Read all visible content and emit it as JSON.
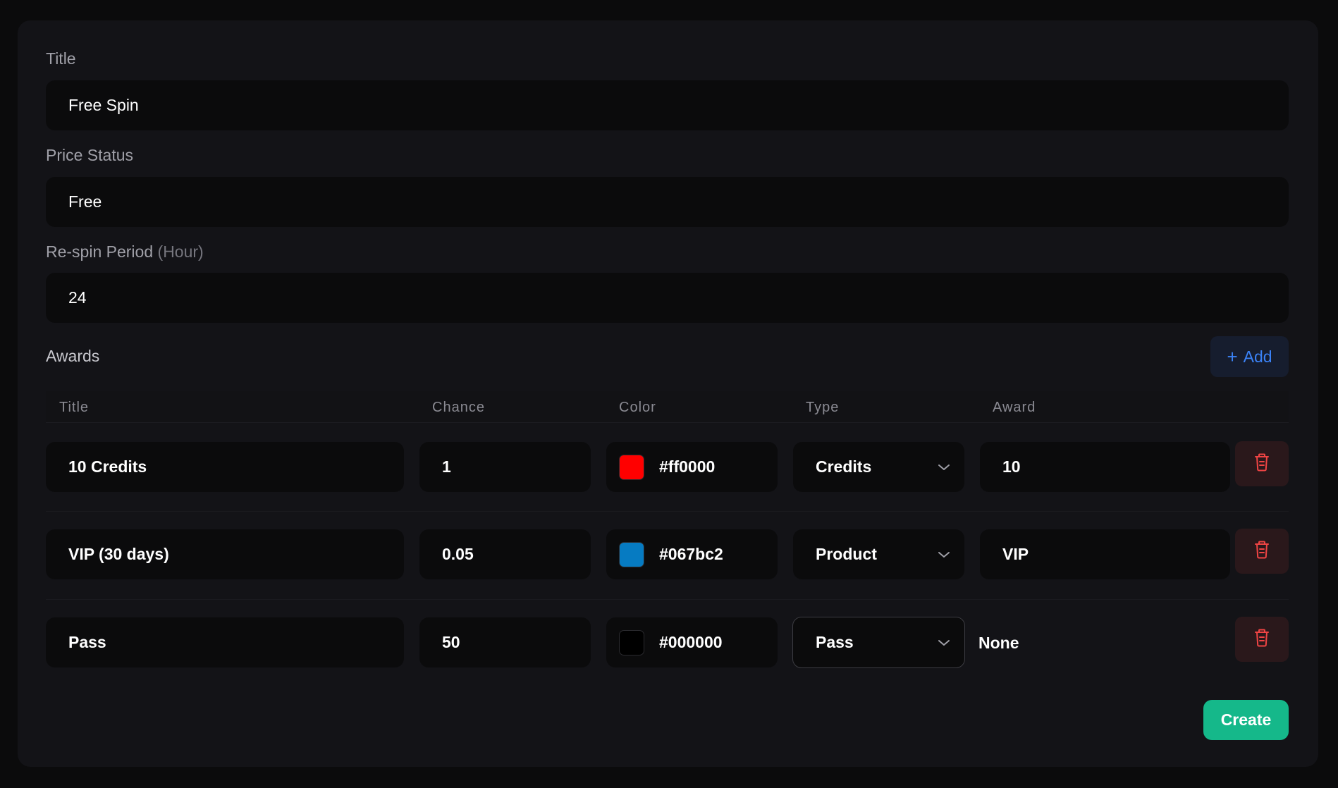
{
  "form": {
    "title": {
      "label": "Title",
      "value": "Free Spin"
    },
    "price_status": {
      "label": "Price Status",
      "value": "Free"
    },
    "respin": {
      "label": "Re-spin Period",
      "unit": "(Hour)",
      "value": "24"
    }
  },
  "awards": {
    "label": "Awards",
    "add_label": "Add",
    "columns": [
      "Title",
      "Chance",
      "Color",
      "Type",
      "Award"
    ],
    "rows": [
      {
        "title": "10 Credits",
        "chance": "1",
        "color": "#ff0000",
        "type": "Credits",
        "award": "10"
      },
      {
        "title": "VIP (30 days)",
        "chance": "0.05",
        "color": "#067bc2",
        "type": "Product",
        "award": "VIP"
      },
      {
        "title": "Pass",
        "chance": "50",
        "color": "#000000",
        "type": "Pass",
        "award": "None"
      }
    ]
  },
  "actions": {
    "create_label": "Create"
  },
  "icons": {
    "add": "plus-icon",
    "delete": "trash-icon",
    "select": "chevron-down-icon"
  },
  "colors": {
    "accent": "#3b82f6",
    "success": "#15b88a",
    "danger": "#ef4444"
  }
}
